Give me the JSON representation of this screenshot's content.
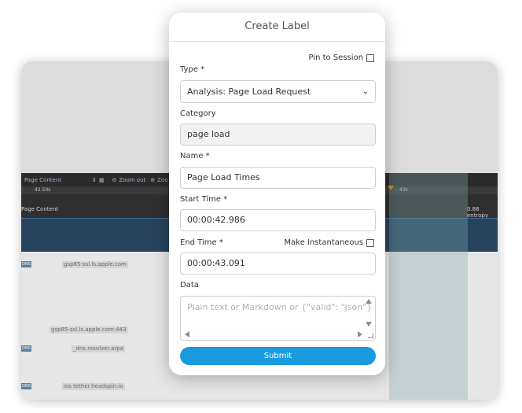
{
  "background": {
    "toolbar": {
      "dropdown_label": "Page Content",
      "zoom_out_label": "Zoom out",
      "zoom_in_label": "Zoo"
    },
    "ruler": {
      "left_label": "42.50s",
      "right_label": "43s"
    },
    "track": {
      "left_label": "Page Content",
      "right_label": "0.88 entropy"
    },
    "dns_rows": [
      {
        "tag": "DNS",
        "host": "gsp85-ssl.ls.apple.com"
      },
      {
        "tag": "",
        "host": "gsp85-ssl.ls.apple.com:443"
      },
      {
        "tag": "DNS",
        "host": "_dns.resolver.arpa"
      },
      {
        "tag": "DNS",
        "host": "ios.tether.headspin.io"
      }
    ]
  },
  "modal": {
    "title": "Create Label",
    "pin_to_session": {
      "label": "Pin to Session",
      "checked": false
    },
    "type": {
      "label": "Type *",
      "value": "Analysis: Page Load Request"
    },
    "category": {
      "label": "Category",
      "value": "page load"
    },
    "name": {
      "label": "Name *",
      "value": "Page Load Times"
    },
    "start_time": {
      "label": "Start Time *",
      "value": "00:00:42.986"
    },
    "end_time": {
      "label": "End Time *",
      "value": "00:00:43.091"
    },
    "make_instantaneous": {
      "label": "Make Instantaneous",
      "checked": false
    },
    "data": {
      "label": "Data",
      "placeholder": "Plain text or Markdown or {\"valid\": \"json\"}"
    },
    "submit_label": "Submit"
  },
  "colors": {
    "accent": "#1a9be0",
    "overlay_panel": "#27435c"
  }
}
